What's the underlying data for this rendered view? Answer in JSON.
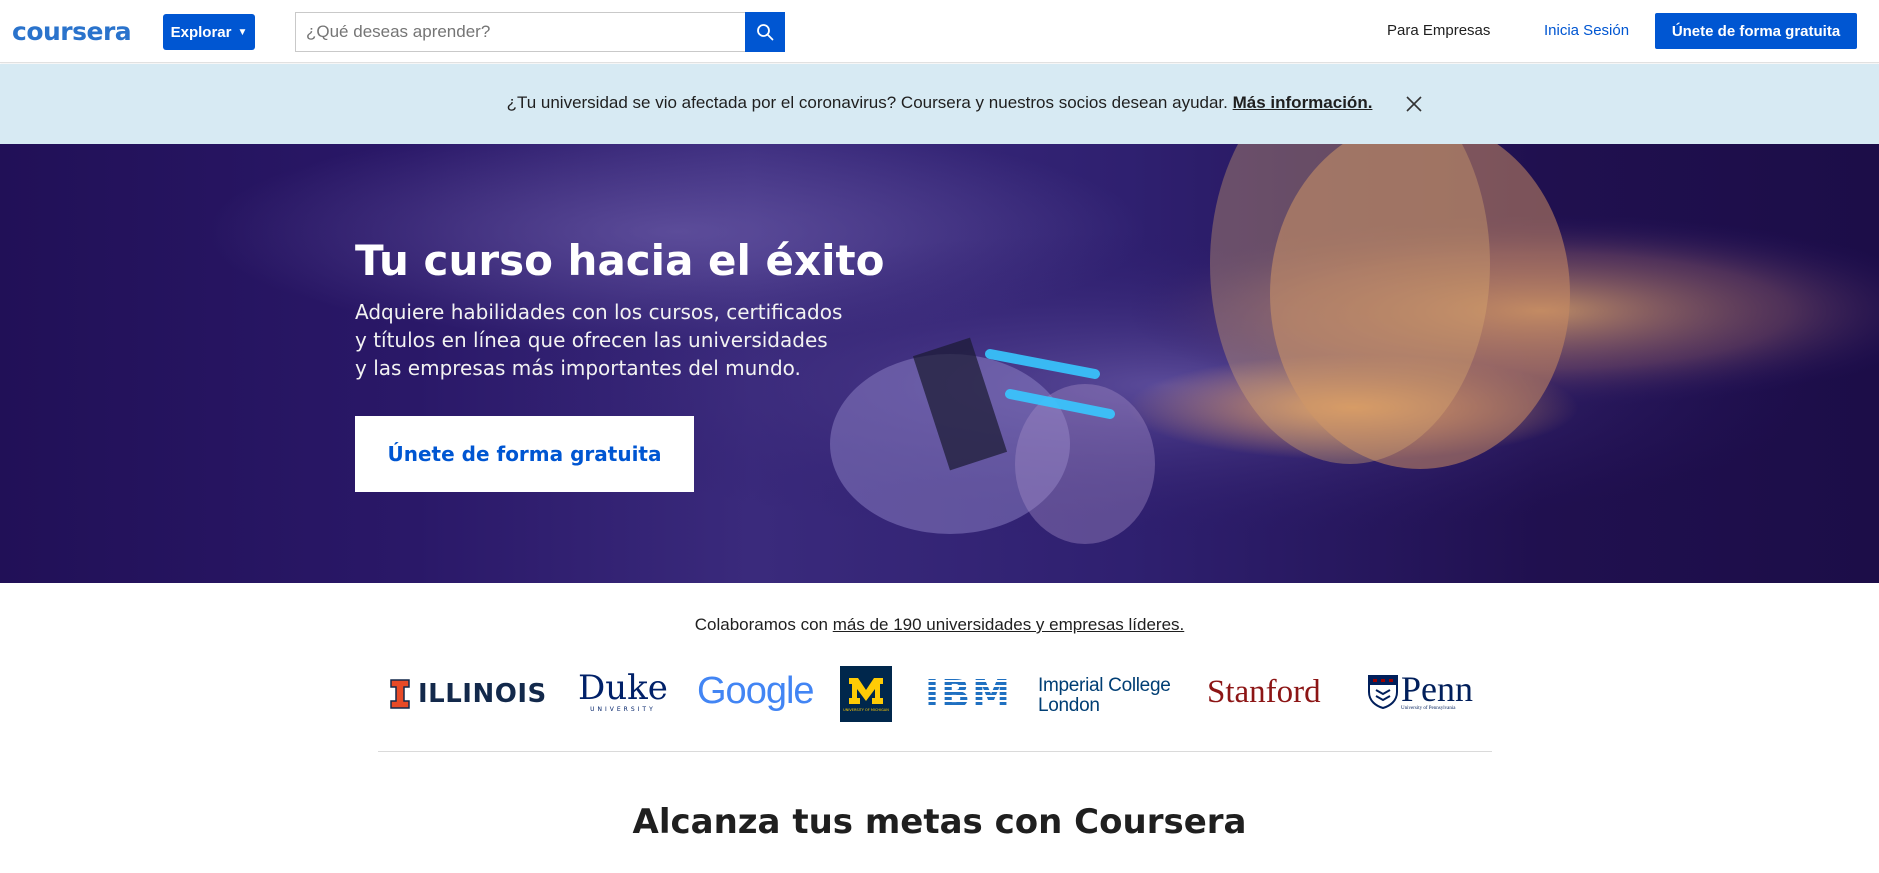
{
  "header": {
    "logo": "coursera",
    "explore_label": "Explorar",
    "search_placeholder": "¿Qué deseas aprender?",
    "business_link": "Para Empresas",
    "login_link": "Inicia Sesión",
    "join_button": "Únete de forma gratuita",
    "accent_color": "#0056d2"
  },
  "banner": {
    "text": "¿Tu universidad se vio afectada por el coronavirus? Coursera y nuestros socios desean ayudar.",
    "link": "Más información.",
    "background": "#d7eaf3"
  },
  "hero": {
    "title": "Tu curso hacia el éxito",
    "subtitle": "Adquiere habilidades con los cursos, certificados y títulos en línea que ofrecen las universidades y las empresas más importantes del mundo.",
    "cta": "Únete de forma gratuita"
  },
  "partners": {
    "intro": "Colaboramos con",
    "link": "más de 190 universidades y empresas líderes.",
    "logos": {
      "illinois": "ILLINOIS",
      "duke": "Duke",
      "duke_sub": "UNIVERSITY",
      "google": "Google",
      "michigan_sub": "UNIVERSITY OF MICHIGAN",
      "ibm": "IBM",
      "imperial_1": "Imperial College",
      "imperial_2": "London",
      "stanford": "Stanford",
      "penn": "Penn",
      "penn_sub": "University of Pennsylvania"
    }
  },
  "section": {
    "title": "Alcanza tus metas con Coursera"
  }
}
